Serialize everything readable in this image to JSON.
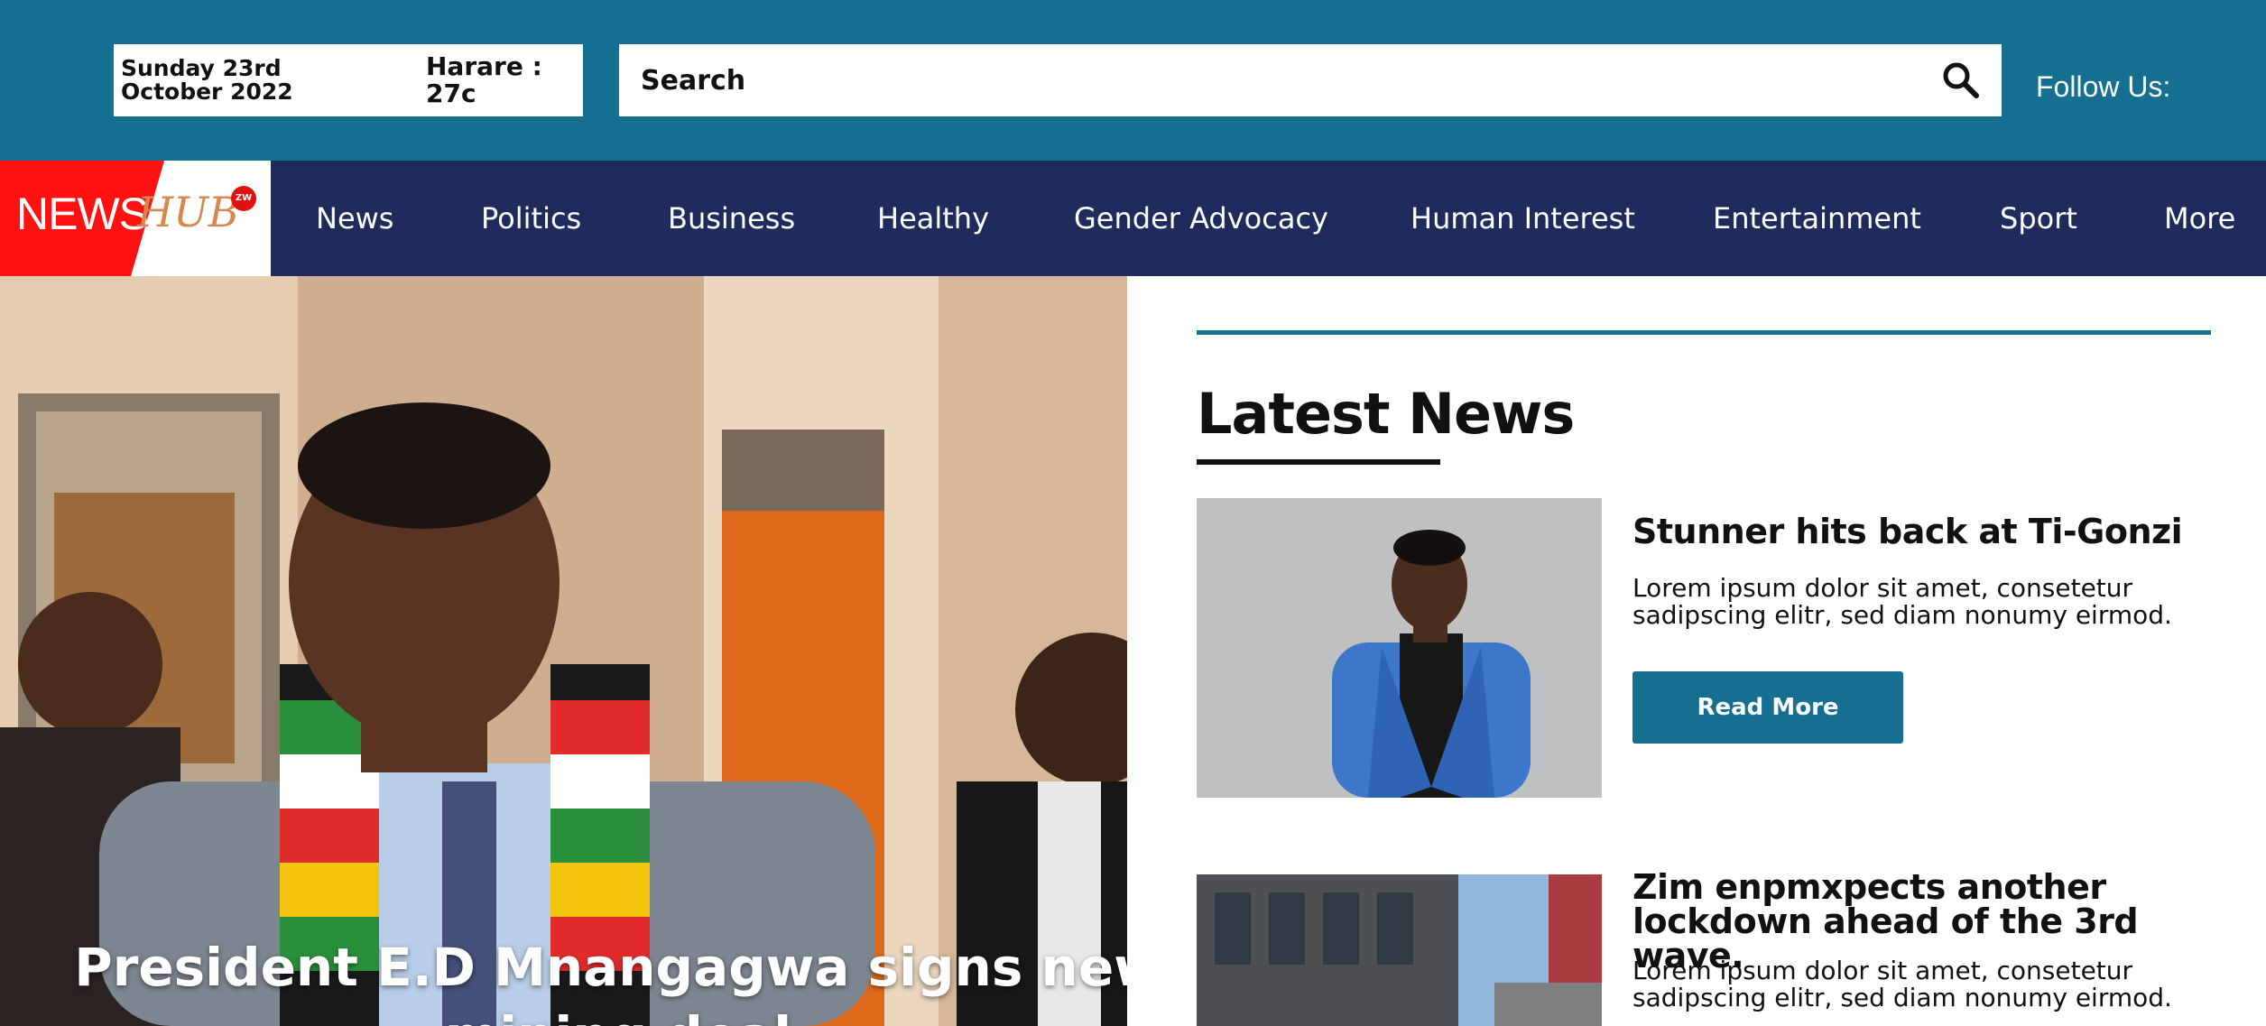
{
  "header": {
    "date": "Sunday 23rd October 2022",
    "weather": "Harare : 27c",
    "search_placeholder": "Search",
    "follow_label": "Follow Us:"
  },
  "logo": {
    "part1": "NEWS",
    "part2": "HUB",
    "badge": "ZW"
  },
  "nav": {
    "items": [
      "News",
      "Politics",
      "Business",
      "Healthy",
      "Gender Advocacy",
      "Human Interest",
      "Entertainment",
      "Sport",
      "More"
    ]
  },
  "hero": {
    "title": "President E.D Mnangagwa signs new mining deal"
  },
  "latest": {
    "heading": "Latest News",
    "articles": [
      {
        "title": "Stunner hits back at Ti-Gonzi",
        "excerpt": "Lorem ipsum dolor sit amet, consetetur sadipscing elitr, sed diam nonumy eirmod.",
        "button": "Read More"
      },
      {
        "title": "Zim enpmxpects another lockdown ahead of the 3rd wave.",
        "excerpt": "Lorem ipsum dolor sit amet, consetetur sadipscing elitr, sed diam nonumy eirmod."
      }
    ]
  },
  "colors": {
    "header_bg": "#156f90",
    "nav_bg": "#1e2b5c",
    "logo_red": "#ff1111",
    "button_bg": "#156f90"
  },
  "icons": {
    "search": "search-icon"
  }
}
